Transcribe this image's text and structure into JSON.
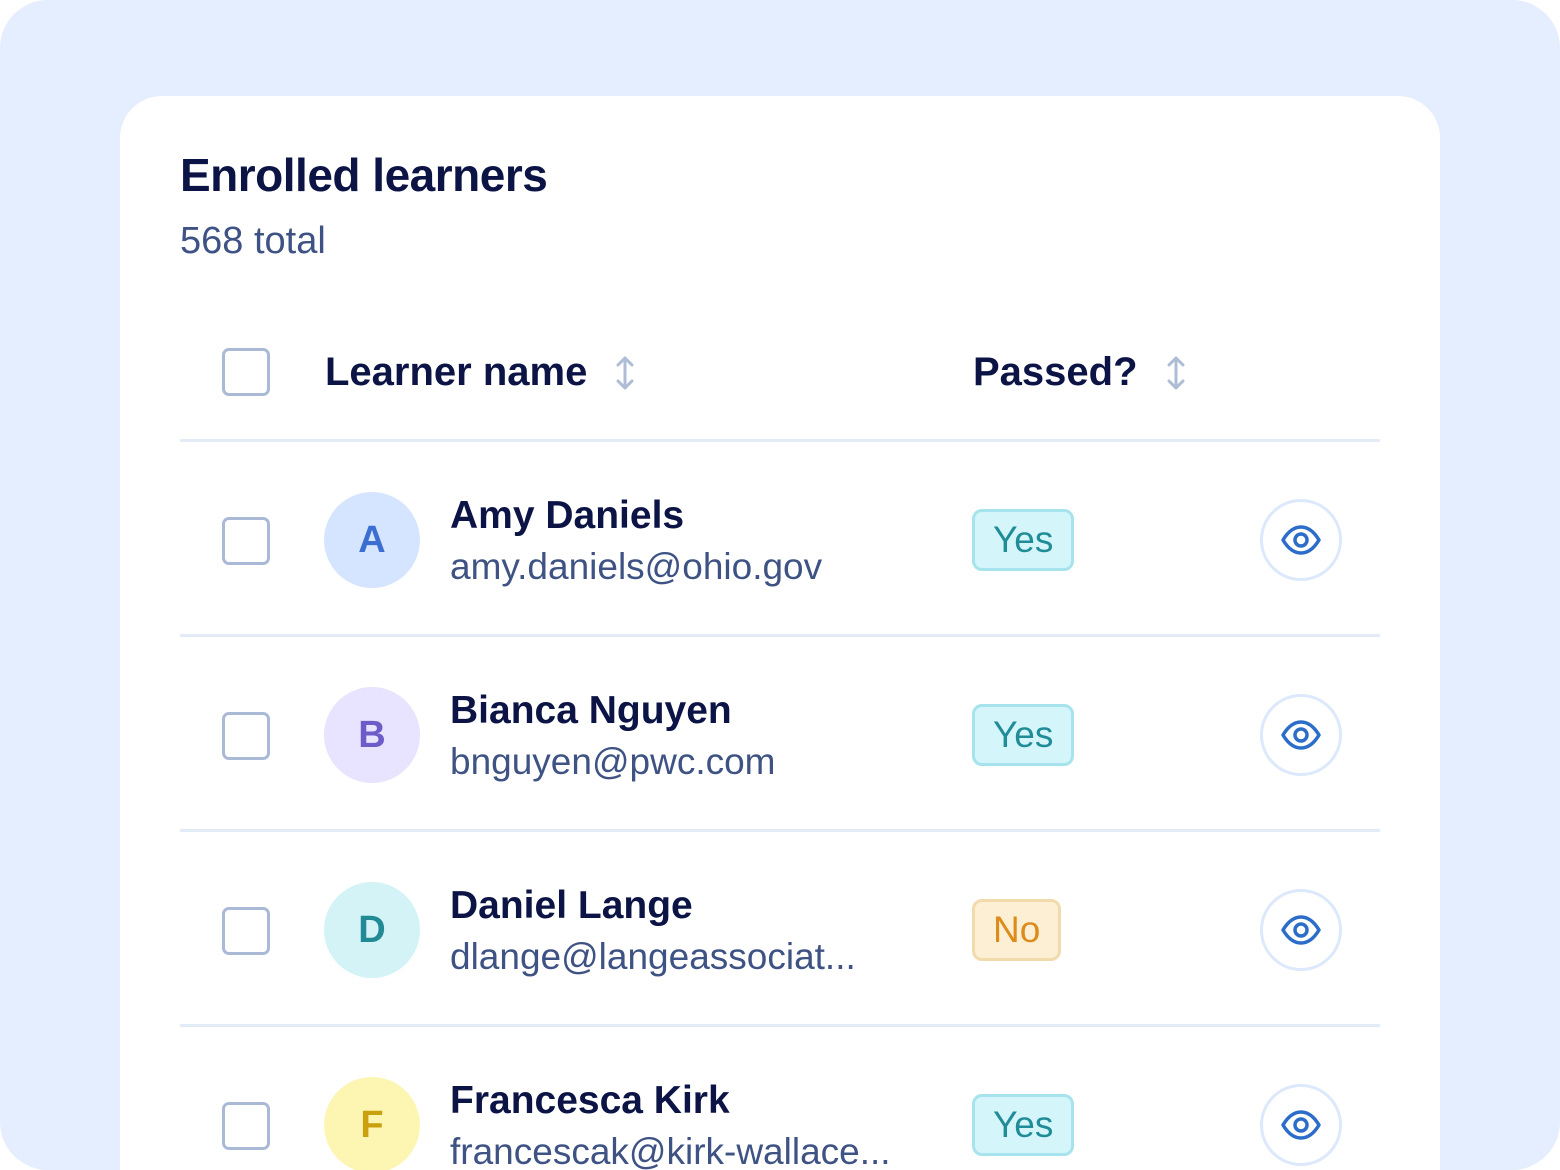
{
  "colors": {
    "page_background": "#e4eeff",
    "card_background": "#ffffff",
    "text_primary": "#0c1445",
    "text_secondary": "#3e5384",
    "badge_yes_text": "#1f8c97",
    "badge_no_text": "#dd8b1a",
    "icon_blue": "#2c6dc9"
  },
  "card": {
    "title": "Enrolled learners",
    "subtitle": "568 total"
  },
  "table": {
    "columns": {
      "name": "Learner name",
      "passed": "Passed?"
    },
    "rows": [
      {
        "initial": "A",
        "name": "Amy Daniels",
        "email": "amy.daniels@ohio.gov",
        "passed": "Yes"
      },
      {
        "initial": "B",
        "name": "Bianca Nguyen",
        "email": "bnguyen@pwc.com",
        "passed": "Yes"
      },
      {
        "initial": "D",
        "name": "Daniel Lange",
        "email": "dlange@langeassociat...",
        "passed": "No"
      },
      {
        "initial": "F",
        "name": "Francesca Kirk",
        "email": "francescak@kirk-wallace...",
        "passed": "Yes"
      }
    ]
  },
  "icons": {
    "sort": "sort-arrows-icon",
    "view": "eye-icon"
  }
}
